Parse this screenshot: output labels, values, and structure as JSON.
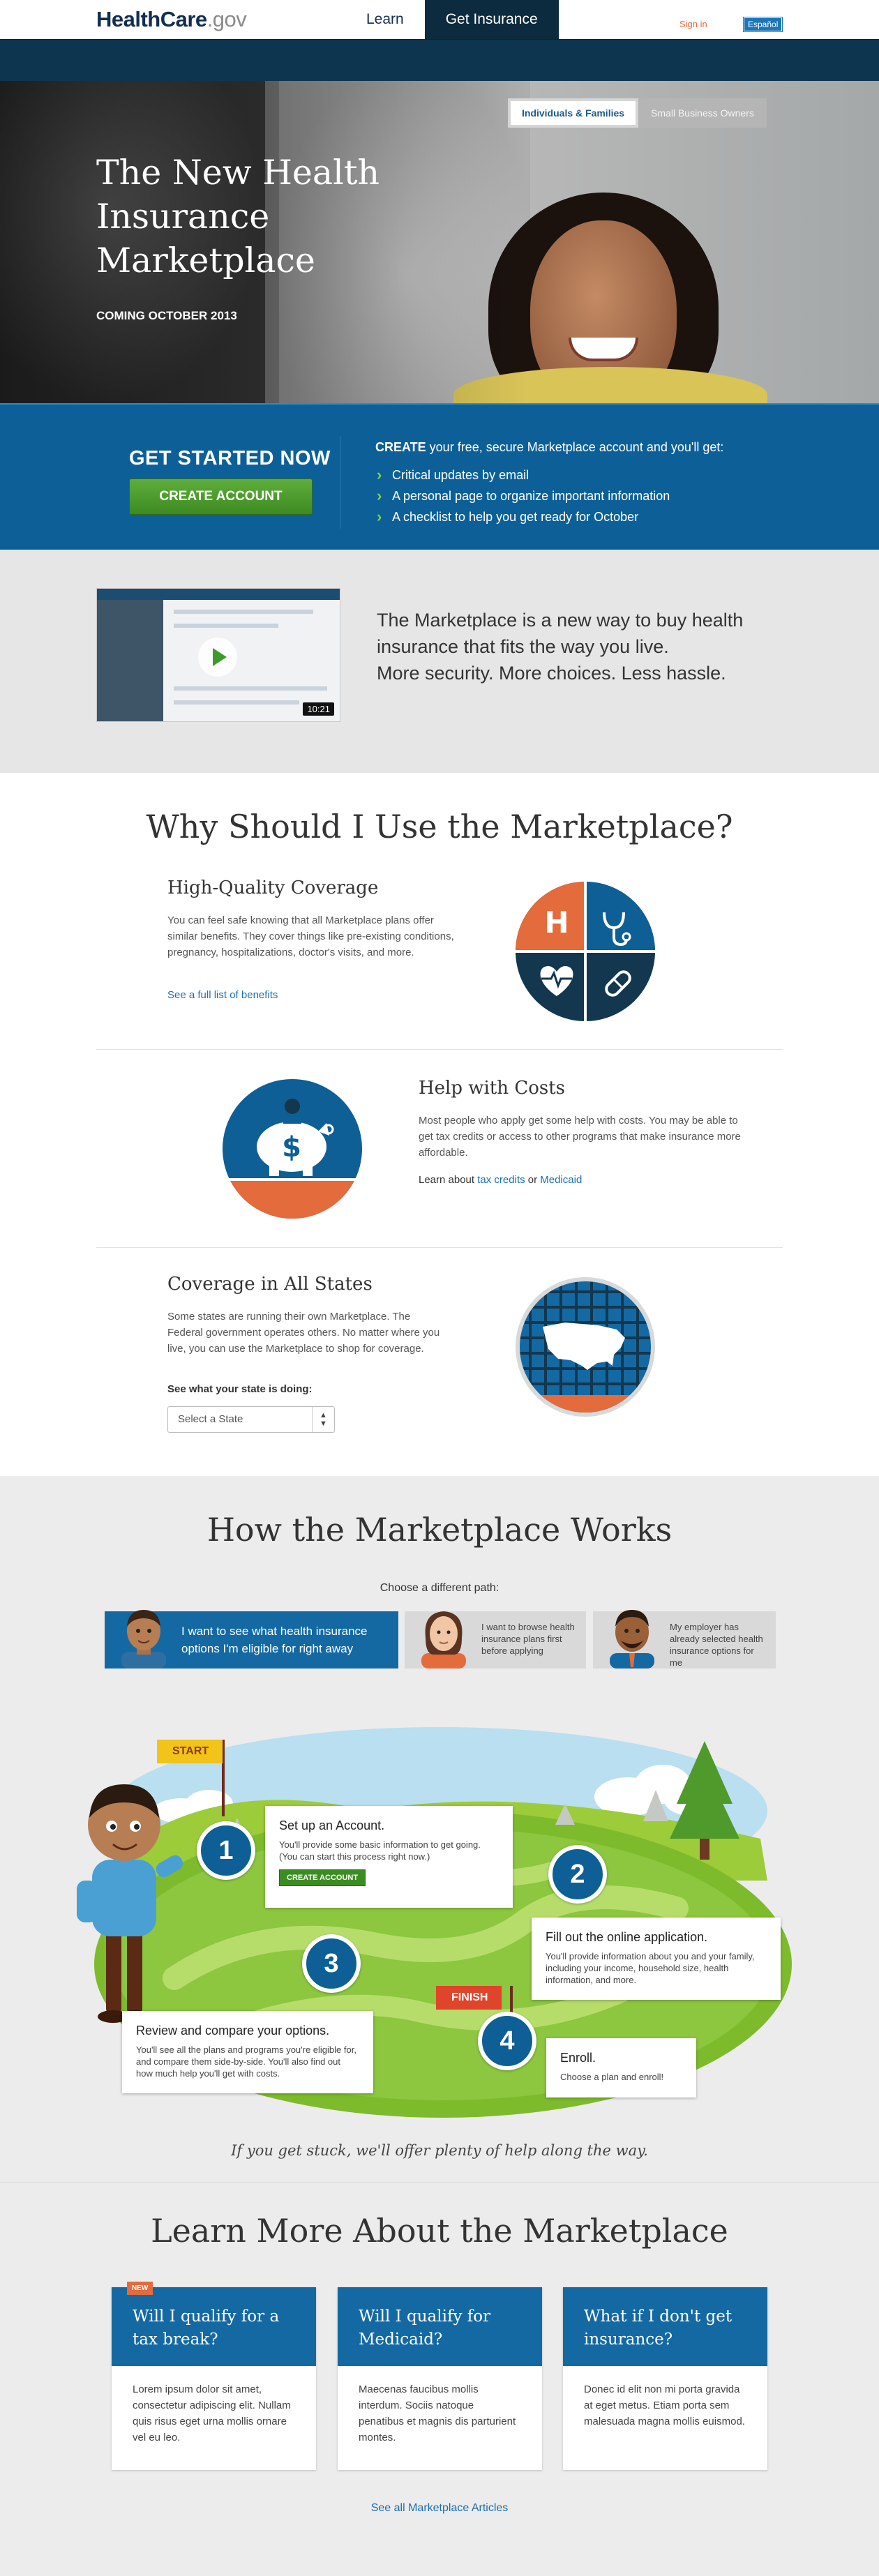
{
  "header": {
    "logo_main": "HealthCare",
    "logo_suffix": ".gov",
    "nav": [
      {
        "label": "Learn",
        "active": false
      },
      {
        "label": "Get Insurance",
        "active": true
      }
    ],
    "sign_in": "Sign in",
    "language": "Español"
  },
  "hero": {
    "title": "The New Health Insurance Marketplace",
    "subtitle": "COMING OCTOBER 2013",
    "audience_tabs": [
      {
        "label": "Individuals & Families",
        "selected": true
      },
      {
        "label": "Small Business Owners",
        "selected": false
      }
    ]
  },
  "get_started": {
    "title": "GET STARTED NOW",
    "button": "CREATE ACCOUNT",
    "lead_bold": "CREATE",
    "lead_rest": " your free, secure Marketplace account and you'll get:",
    "items": [
      "Critical updates by email",
      "A personal page to organize important information",
      "A checklist to help you get ready for October"
    ]
  },
  "video": {
    "duration": "10:21",
    "text_line1": "The Marketplace is a new way to buy health insurance that fits the way you live.",
    "text_line2": "More security. More choices. Less hassle."
  },
  "why": {
    "title": "Why Should I Use the Marketplace?",
    "features": [
      {
        "title": "High-Quality Coverage",
        "text": "You can feel safe knowing that all Marketplace plans offer similar benefits. They cover things like pre-existing conditions, pregnancy, hospitalizations, doctor's visits, and more.",
        "link": "See a full list of benefits"
      },
      {
        "title": "Help with Costs",
        "text": "Most people who apply get some help with costs. You may be able to get tax credits or access to other programs that make insurance more affordable.",
        "learn_prefix": "Learn about ",
        "link1": "tax credits",
        "joiner": " or ",
        "link2": "Medicaid"
      },
      {
        "title": "Coverage in All States",
        "text": "Some states are running their own Marketplace. The Federal government operates others. No matter where you live, you can use the Marketplace to shop for coverage.",
        "prompt": "See what your state is doing:",
        "select_value": "Select a State"
      }
    ],
    "icon_letter": "H",
    "colors": {
      "orange": "#e36b3c",
      "blue": "#0e5f95",
      "navy": "#12374f"
    }
  },
  "how": {
    "title": "How the Marketplace Works",
    "choose": "Choose a different path:",
    "paths": [
      {
        "label": "I want to see what health insurance options I'm eligible for right away",
        "selected": true
      },
      {
        "label": "I want to browse health insurance plans first before applying",
        "selected": false
      },
      {
        "label": "My employer has already selected health insurance options for me",
        "selected": false
      }
    ],
    "flag_start": "START",
    "flag_finish": "FINISH",
    "steps": [
      {
        "num": "1",
        "title": "Set up an Account.",
        "text": "You'll provide some basic information to get going. (You can start this process right now.)",
        "button": "CREATE ACCOUNT"
      },
      {
        "num": "2",
        "title": "Fill out the online application.",
        "text": "You'll provide information about you and your family, including your income, household size, health information, and more."
      },
      {
        "num": "3",
        "title": "Review and compare your options.",
        "text": "You'll see all the plans and programs you're eligible for, and compare them side-by-side. You'll also find out how much help you'll get with costs."
      },
      {
        "num": "4",
        "title": "Enroll.",
        "text": "Choose a plan and enroll!"
      }
    ],
    "stuck": "If you get stuck, we'll offer plenty of help along the way."
  },
  "learn": {
    "title": "Learn More About the Marketplace",
    "new_tag": "NEW",
    "articles": [
      {
        "title": "Will I qualify for a tax break?",
        "text": "Lorem ipsum dolor sit amet, consectetur adipiscing elit. Nullam quis risus eget urna mollis ornare vel eu leo."
      },
      {
        "title": "Will I qualify for Medicaid?",
        "text": "Maecenas faucibus mollis interdum. Sociis natoque penatibus et magnis dis parturient montes."
      },
      {
        "title": "What if I don't get insurance?",
        "text": "Donec id elit non mi porta gravida at eget metus. Etiam porta sem malesuada magna mollis euismod."
      }
    ],
    "see_all": "See all Marketplace Articles"
  }
}
